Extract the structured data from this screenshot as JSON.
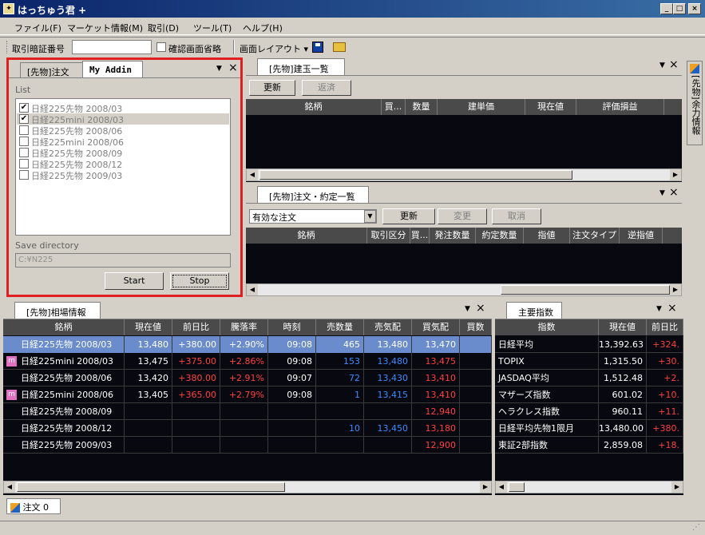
{
  "window": {
    "title": "はっちゅう君 +",
    "min": "_",
    "max": "□",
    "close": "×"
  },
  "menu": [
    "ファイル(F)",
    "マーケット情報(M)",
    "取引(D)",
    "ツール(T)",
    "ヘルプ(H)"
  ],
  "toolbar": {
    "pin_label": "取引暗証番号",
    "confirm_label": "確認画面省略",
    "layout_label": "画面レイアウト ▾"
  },
  "addin": {
    "tab_order": "[先物]注文",
    "tab_addin": "My Addin",
    "list_label": "List",
    "items": [
      {
        "label": "日経225先物 2008/03",
        "checked": true
      },
      {
        "label": "日経225mini 2008/03",
        "checked": true
      },
      {
        "label": "日経225先物 2008/06",
        "checked": false
      },
      {
        "label": "日経225mini 2008/06",
        "checked": false
      },
      {
        "label": "日経225先物 2008/09",
        "checked": false
      },
      {
        "label": "日経225先物 2008/12",
        "checked": false
      },
      {
        "label": "日経225先物 2009/03",
        "checked": false
      }
    ],
    "save_label": "Save directory",
    "save_value": "C:¥N225",
    "start": "Start",
    "stop": "Stop"
  },
  "positions": {
    "tab": "[先物]建玉一覧",
    "refresh": "更新",
    "settle": "返済",
    "columns": [
      "銘柄",
      "買...",
      "数量",
      "建単価",
      "現在値",
      "評価損益"
    ]
  },
  "orders": {
    "tab": "[先物]注文・約定一覧",
    "filter": "有効な注文",
    "refresh": "更新",
    "modify": "変更",
    "cancel": "取消",
    "columns": [
      "銘柄",
      "取引区分",
      "買...",
      "発注数量",
      "約定数量",
      "指値",
      "注文タイプ",
      "逆指値"
    ]
  },
  "market": {
    "tab": "[先物]相場情報",
    "columns": [
      "銘柄",
      "現在値",
      "前日比",
      "騰落率",
      "時刻",
      "売数量",
      "売気配",
      "買気配",
      "買数"
    ],
    "rows": [
      {
        "badge": "",
        "name": "日経225先物 2008/03",
        "price": "13,480",
        "chg": "+380.00",
        "pct": "+2.90%",
        "time": "09:08",
        "askq": "465",
        "ask": "13,480",
        "bid": "13,470",
        "sel": true
      },
      {
        "badge": "m",
        "name": "日経225mini 2008/03",
        "price": "13,475",
        "chg": "+375.00",
        "pct": "+2.86%",
        "time": "09:08",
        "askq": "153",
        "ask": "13,480",
        "bid": "13,475",
        "sel": false
      },
      {
        "badge": "",
        "name": "日経225先物 2008/06",
        "price": "13,420",
        "chg": "+380.00",
        "pct": "+2.91%",
        "time": "09:07",
        "askq": "72",
        "ask": "13,430",
        "bid": "13,410",
        "sel": false
      },
      {
        "badge": "m",
        "name": "日経225mini 2008/06",
        "price": "13,405",
        "chg": "+365.00",
        "pct": "+2.79%",
        "time": "09:08",
        "askq": "1",
        "ask": "13,415",
        "bid": "13,410",
        "sel": false
      },
      {
        "badge": "",
        "name": "日経225先物 2008/09",
        "price": "",
        "chg": "",
        "pct": "",
        "time": "",
        "askq": "",
        "ask": "",
        "bid": "12,940",
        "sel": false
      },
      {
        "badge": "",
        "name": "日経225先物 2008/12",
        "price": "",
        "chg": "",
        "pct": "",
        "time": "",
        "askq": "10",
        "ask": "13,450",
        "bid": "13,180",
        "sel": false
      },
      {
        "badge": "",
        "name": "日経225先物 2009/03",
        "price": "",
        "chg": "",
        "pct": "",
        "time": "",
        "askq": "",
        "ask": "",
        "bid": "12,900",
        "sel": false
      }
    ]
  },
  "indices": {
    "tab": "主要指数",
    "columns": [
      "指数",
      "現在値",
      "前日比"
    ],
    "rows": [
      {
        "name": "日経平均",
        "price": "13,392.63",
        "chg": "+324."
      },
      {
        "name": "TOPIX",
        "price": "1,315.50",
        "chg": "+30."
      },
      {
        "name": "JASDAQ平均",
        "price": "1,512.48",
        "chg": "+2."
      },
      {
        "name": "マザーズ指数",
        "price": "601.02",
        "chg": "+10."
      },
      {
        "name": "ヘラクレス指数",
        "price": "960.11",
        "chg": "+11."
      },
      {
        "name": "日経平均先物1限月",
        "price": "13,480.00",
        "chg": "+380."
      },
      {
        "name": "東証2部指数",
        "price": "2,859.08",
        "chg": "+18."
      }
    ]
  },
  "side_tab": "[先物]余力情報",
  "bottom_tab": "注文 0",
  "colors": {
    "title": "#0a246a",
    "grid": "#080810",
    "header": "#4a4a4a",
    "red": "#ff4040",
    "blue": "#3a8cff",
    "highlight": "#e02020"
  }
}
